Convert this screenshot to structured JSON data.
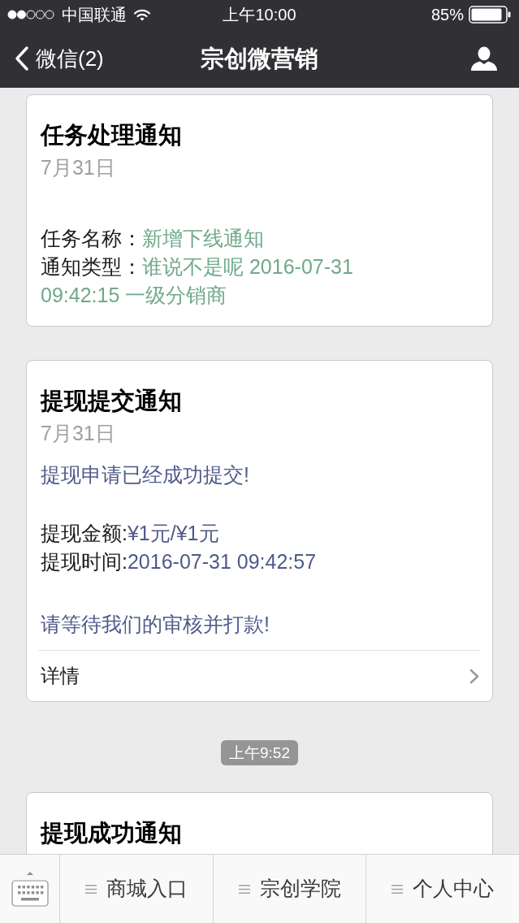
{
  "status_bar": {
    "carrier": "中国联通",
    "time": "上午10:00",
    "battery": "85%"
  },
  "nav_bar": {
    "back_label": "微信(2)",
    "title": "宗创微营销"
  },
  "messages": [
    {
      "kind": "card",
      "title": "任务处理通知",
      "date": "7月31日",
      "color": "#6fa98a",
      "fields": [
        {
          "label": "任务名称：",
          "value": "新增下线通知"
        },
        {
          "label": "通知类型：",
          "value": "谁说不是呢 2016-07-31 09:42:15 一级分销商"
        }
      ]
    },
    {
      "kind": "card",
      "title": "提现提交通知",
      "date": "7月31日",
      "color": "#4f5a8a",
      "intro": "提现申请已经成功提交!",
      "fields": [
        {
          "label": "提现金额:",
          "value": "¥1元/¥1元"
        },
        {
          "label": "提现时间:",
          "value": "2016-07-31 09:42:57"
        }
      ],
      "remark": "请等待我们的审核并打款!",
      "link": "详情"
    },
    {
      "kind": "time",
      "text": "上午9:52"
    },
    {
      "kind": "card",
      "title": "提现成功通知"
    }
  ],
  "menu": {
    "items": [
      "商城入口",
      "宗创学院",
      "个人中心"
    ]
  }
}
